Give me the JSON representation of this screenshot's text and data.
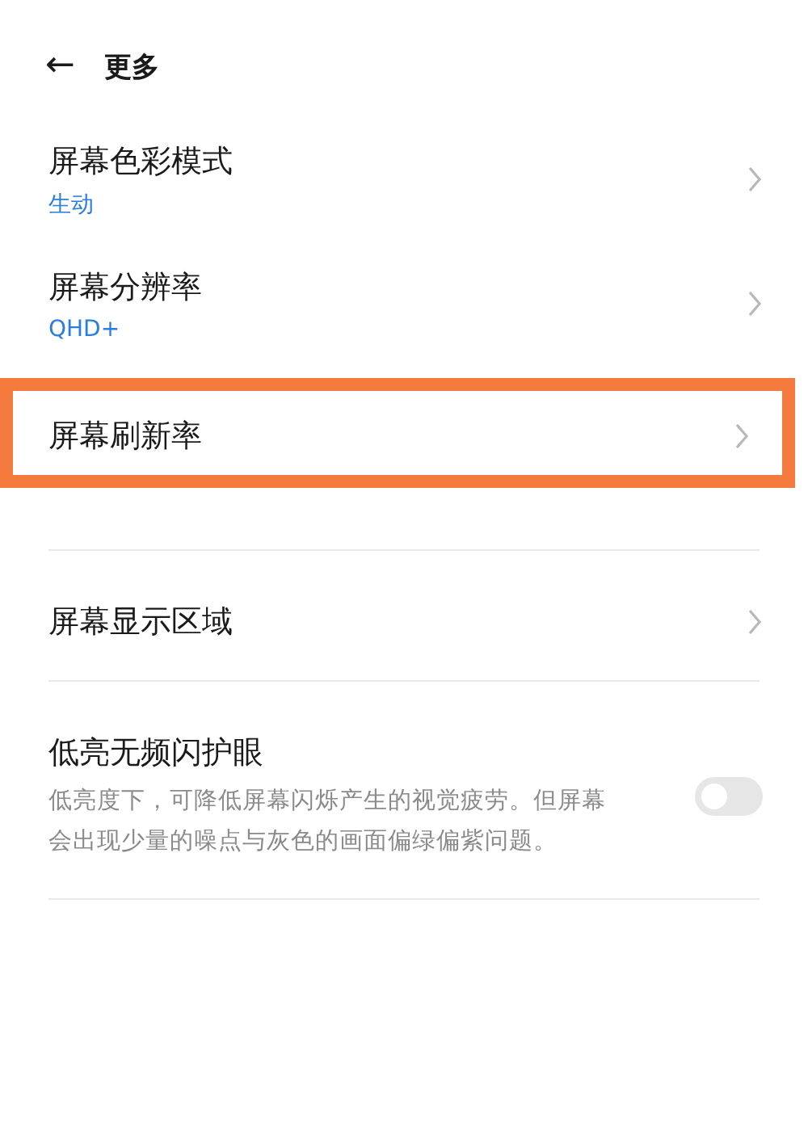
{
  "header": {
    "back_icon": "←",
    "title": "更多"
  },
  "items": [
    {
      "kind": "link",
      "title": "屏幕色彩模式",
      "value": "生动",
      "highlighted": false
    },
    {
      "kind": "link",
      "title": "屏幕分辨率",
      "value": "QHD+",
      "highlighted": false
    },
    {
      "kind": "link",
      "title": "屏幕刷新率",
      "highlighted": true
    },
    {
      "kind": "link",
      "title": "屏幕显示区域",
      "highlighted": false
    },
    {
      "kind": "switch",
      "title": "低亮无频闪护眼",
      "description": "低亮度下，可降低屏幕闪烁产生的视觉疲劳。但屏幕会出现少量的噪点与灰色的画面偏绿偏紫问题。",
      "on": false,
      "highlighted": false
    }
  ]
}
